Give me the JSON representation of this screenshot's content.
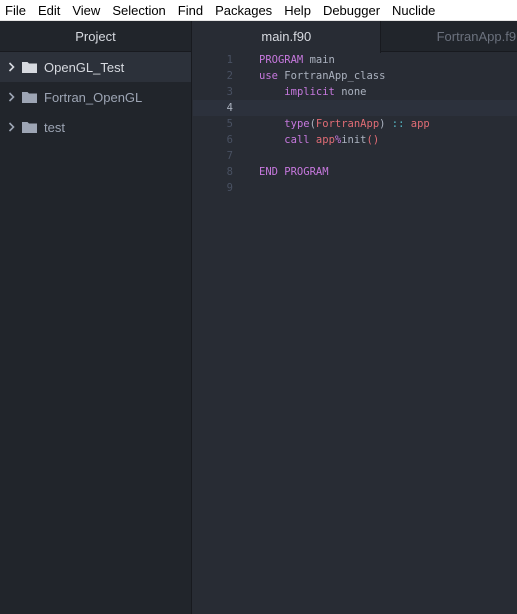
{
  "menu": [
    "File",
    "Edit",
    "View",
    "Selection",
    "Find",
    "Packages",
    "Help",
    "Debugger",
    "Nuclide"
  ],
  "sidebar": {
    "title": "Project",
    "items": [
      {
        "label": "OpenGL_Test",
        "selected": true
      },
      {
        "label": "Fortran_OpenGL",
        "selected": false
      },
      {
        "label": "test",
        "selected": false
      }
    ]
  },
  "tabs": {
    "active": "main.f90",
    "inactive": "FortranApp.f9"
  },
  "code": {
    "line_numbers": [
      "1",
      "2",
      "3",
      "4",
      "5",
      "6",
      "7",
      "8",
      "9"
    ],
    "cursor_line": 4,
    "l1": {
      "kw": "PROGRAM",
      "id": " main"
    },
    "l2": {
      "kw": "use",
      "id": " FortranApp_class"
    },
    "l3": {
      "indent": "    ",
      "kw": "implicit",
      "id": " none"
    },
    "l5": {
      "indent": "    ",
      "kw": "type",
      "p1": "(",
      "ty": "FortranApp",
      "p2": ")",
      "op": " :: ",
      "id": "app"
    },
    "l6": {
      "indent": "    ",
      "kw": "call",
      "sp": " ",
      "id": "app",
      "op": "%",
      "fn": "init",
      "pn": "()"
    },
    "l8": {
      "kw": "END",
      "id": " PROGRAM"
    }
  },
  "colors": {
    "keyword": "#c678dd",
    "type": "#e06c75",
    "operator": "#56b6c2",
    "text": "#abb2bf",
    "background": "#282c34",
    "sidebar": "#21252b"
  }
}
